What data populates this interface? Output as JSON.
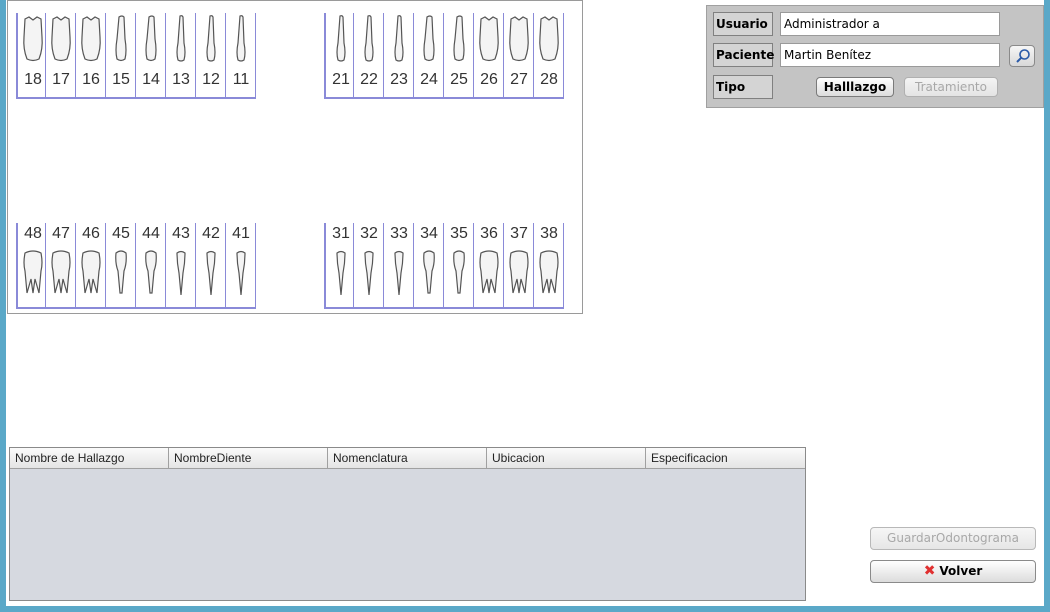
{
  "odontograma": {
    "upper_right": [
      "18",
      "17",
      "16",
      "15",
      "14",
      "13",
      "12",
      "11"
    ],
    "upper_left": [
      "21",
      "22",
      "23",
      "24",
      "25",
      "26",
      "27",
      "28"
    ],
    "lower_right": [
      "48",
      "47",
      "46",
      "45",
      "44",
      "43",
      "42",
      "41"
    ],
    "lower_left": [
      "31",
      "32",
      "33",
      "34",
      "35",
      "36",
      "37",
      "38"
    ]
  },
  "panel": {
    "usuario_label": "Usuario",
    "usuario_value": "Administrador a",
    "paciente_label": "Paciente",
    "paciente_value": "Martin Benítez",
    "tipo_label": "Tipo",
    "hallazgo_button": "Halllazgo",
    "tratamiento_button": "Tratamiento"
  },
  "table": {
    "columns": [
      "Nombre de Hallazgo",
      "NombreDiente",
      "Nomenclatura",
      "Ubicacion",
      "Especificacion"
    ]
  },
  "actions": {
    "guardar_label": "GuardarOdontograma",
    "volver_label": "Volver"
  },
  "colors": {
    "frame": "#5aa8c8",
    "tooth_divider": "#8a8ad8",
    "table_body": "#d6d9e0",
    "panel": "#c4c4c4"
  }
}
